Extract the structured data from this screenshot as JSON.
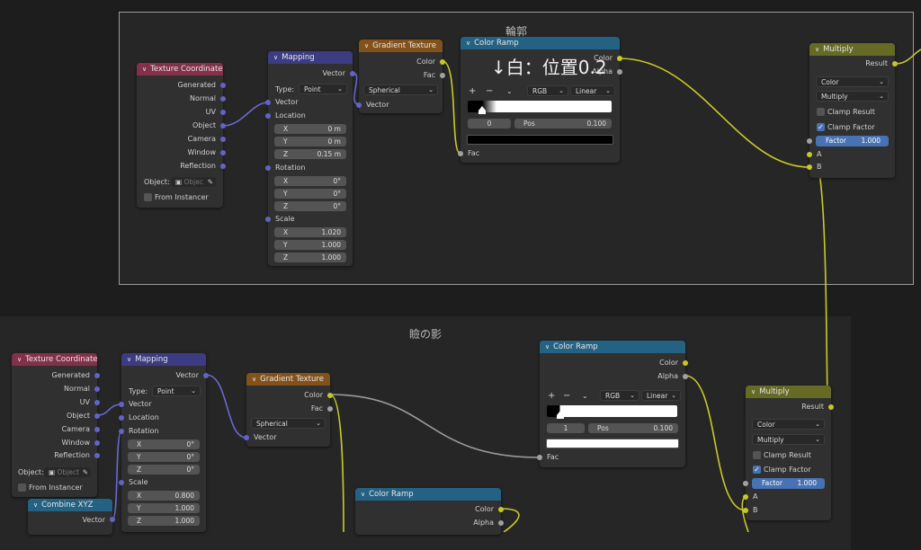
{
  "frames": {
    "outline": {
      "title": "輪郭"
    },
    "eye_shadow": {
      "title": "瞼の影"
    }
  },
  "annotation": {
    "text": "↓白：位置0.2"
  },
  "top": {
    "texcoord": {
      "header": "Texture Coordinate",
      "outputs": [
        "Generated",
        "Normal",
        "UV",
        "Object",
        "Camera",
        "Window",
        "Reflection"
      ],
      "object_label": "Object:",
      "object_placeholder": "Objec",
      "from_instancer": "From Instancer"
    },
    "mapping": {
      "header": "Mapping",
      "out_vector": "Vector",
      "type_label": "Type:",
      "type_value": "Point",
      "in_vector": "Vector",
      "location": "Location",
      "loc": [
        [
          "X",
          "0 m"
        ],
        [
          "Y",
          "0 m"
        ],
        [
          "Z",
          "0.15 m"
        ]
      ],
      "rotation": "Rotation",
      "rot": [
        [
          "X",
          "0°"
        ],
        [
          "Y",
          "0°"
        ],
        [
          "Z",
          "0°"
        ]
      ],
      "scale": "Scale",
      "scl": [
        [
          "X",
          "1.020"
        ],
        [
          "Y",
          "1.000"
        ],
        [
          "Z",
          "1.000"
        ]
      ]
    },
    "gradient": {
      "header": "Gradient Texture",
      "out_color": "Color",
      "out_fac": "Fac",
      "type_value": "Spherical",
      "in_vector": "Vector"
    },
    "ramp": {
      "header": "Color Ramp",
      "out_color": "Color",
      "out_alpha": "Alpha",
      "plus": "+",
      "minus": "−",
      "mode": "RGB",
      "interp": "Linear",
      "index": "0",
      "pos_label": "Pos",
      "pos_value": "0.100",
      "in_fac": "Fac",
      "color_start": "#000000",
      "color_end": "#ffffff",
      "ramp_pos": 0.2,
      "stop_pos": 0.1,
      "active_color": "#000000"
    },
    "multiply": {
      "header": "Multiply",
      "out_result": "Result",
      "type_value": "Color",
      "op_value": "Multiply",
      "clamp_result": "Clamp Result",
      "clamp_factor": "Clamp Factor",
      "factor_label": "Factor",
      "factor_value": "1.000",
      "in_a": "A",
      "in_b": "B"
    }
  },
  "bottom": {
    "texcoord": {
      "header": "Texture Coordinate",
      "outputs": [
        "Generated",
        "Normal",
        "UV",
        "Object",
        "Camera",
        "Window",
        "Reflection"
      ],
      "object_label": "Object:",
      "object_placeholder": "Object",
      "from_instancer": "From Instancer"
    },
    "mapping": {
      "header": "Mapping",
      "out_vector": "Vector",
      "type_label": "Type:",
      "type_value": "Point",
      "in_vector": "Vector",
      "location": "Location",
      "rotation": "Rotation",
      "rot": [
        [
          "X",
          "0°"
        ],
        [
          "Y",
          "0°"
        ],
        [
          "Z",
          "0°"
        ]
      ],
      "scale": "Scale",
      "scl": [
        [
          "X",
          "0.800"
        ],
        [
          "Y",
          "1.000"
        ],
        [
          "Z",
          "1.000"
        ]
      ]
    },
    "combine": {
      "header": "Combine XYZ",
      "out_vector": "Vector"
    },
    "gradient": {
      "header": "Gradient Texture",
      "out_color": "Color",
      "out_fac": "Fac",
      "type_value": "Spherical",
      "in_vector": "Vector"
    },
    "ramp": {
      "header": "Color Ramp",
      "out_color": "Color",
      "out_alpha": "Alpha",
      "plus": "+",
      "minus": "−",
      "mode": "RGB",
      "interp": "Linear",
      "index": "1",
      "pos_label": "Pos",
      "pos_value": "0.100",
      "in_fac": "Fac",
      "color_start": "#000000",
      "color_end": "#ffffff",
      "ramp_pos": 0.1,
      "stop_pos": 0.1,
      "active_color": "#ffffff"
    },
    "ramp2": {
      "header": "Color Ramp",
      "out_color": "Color",
      "out_alpha": "Alpha"
    },
    "multiply": {
      "header": "Multiply",
      "out_result": "Result",
      "type_value": "Color",
      "op_value": "Multiply",
      "clamp_result": "Clamp Result",
      "clamp_factor": "Clamp Factor",
      "factor_label": "Factor",
      "factor_value": "1.000",
      "in_a": "A",
      "in_b": "B"
    }
  },
  "colors": {
    "vector_socket": "#6363c7",
    "color_socket": "#c7c729",
    "float_socket": "#a1a1a1",
    "link_vector": "#6a6ad0",
    "link_color": "#c9c92c",
    "link_float": "#9a9a9a",
    "accent": "#4772b3"
  }
}
